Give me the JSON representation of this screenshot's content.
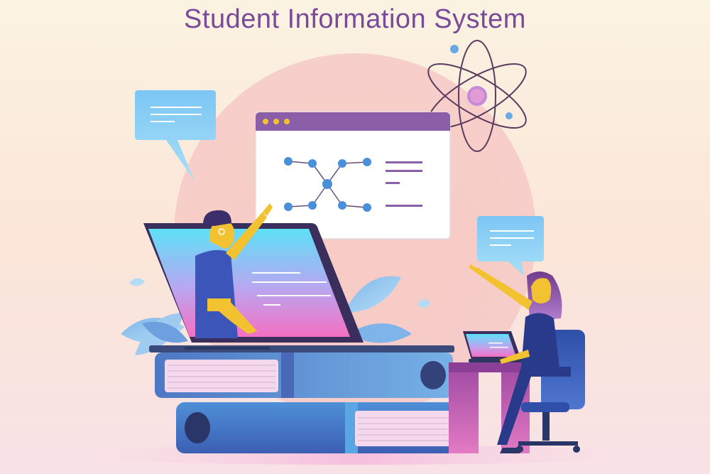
{
  "title": "Student Information System",
  "colors": {
    "title": "#7a4a9a",
    "background_top": "#fbf3e2",
    "background_bottom": "#f8e2e6",
    "accent_purple": "#8b5fa8",
    "accent_blue": "#4a8fd9",
    "skin_yellow": "#f2c230"
  },
  "illustration": {
    "icons": [
      "atom-icon",
      "speech-bubble-icon",
      "browser-window-icon",
      "network-diagram-icon",
      "laptop-icon",
      "book-stack-icon",
      "chair-icon",
      "leaf-icon"
    ]
  }
}
